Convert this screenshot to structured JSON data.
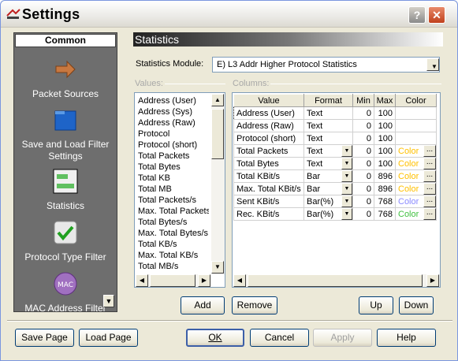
{
  "window": {
    "title": "Settings"
  },
  "left_panel": {
    "header": "Common",
    "items": [
      {
        "label": "Packet Sources",
        "icon": "arrow-icon"
      },
      {
        "label": "Save and Load Filter Settings",
        "icon": "folder-icon"
      },
      {
        "label": "Statistics",
        "icon": "statistics-icon"
      },
      {
        "label": "Protocol Type Filter",
        "icon": "checkmark-icon"
      },
      {
        "label": "MAC Address Filter",
        "icon": "mac-icon"
      }
    ]
  },
  "section_title": "Statistics",
  "module": {
    "label": "Statistics Module:",
    "value": "E)  L3 Addr Higher Protocol Statistics"
  },
  "values_group_label": "Values:",
  "columns_group_label": "Columns:",
  "values_list": [
    "Address (User)",
    "Address (Sys)",
    "Address (Raw)",
    "Protocol",
    "Protocol (short)",
    "Total Packets",
    "Total Bytes",
    "Total KB",
    "Total MB",
    "Total Packets/s",
    "Max. Total Packets",
    "Total Bytes/s",
    "Max. Total Bytes/s",
    "Total KB/s",
    "Max. Total KB/s",
    "Total MB/s"
  ],
  "columns_table": {
    "headers": [
      "Value",
      "Format",
      "Min",
      "Max",
      "Color"
    ],
    "rows": [
      {
        "value": "Address (User)",
        "format": "Text",
        "min": "0",
        "max": "100",
        "color": "",
        "dd": false
      },
      {
        "value": "Address (Raw)",
        "format": "Text",
        "min": "0",
        "max": "100",
        "color": "",
        "dd": false
      },
      {
        "value": "Protocol (short)",
        "format": "Text",
        "min": "0",
        "max": "100",
        "color": "",
        "dd": false
      },
      {
        "value": "Total Packets",
        "format": "Text",
        "min": "0",
        "max": "100",
        "color": "Color",
        "dd": true
      },
      {
        "value": "Total Bytes",
        "format": "Text",
        "min": "0",
        "max": "100",
        "color": "Color",
        "dd": true
      },
      {
        "value": "Total KBit/s",
        "format": "Bar",
        "min": "0",
        "max": "896",
        "color": "Color",
        "dd": true
      },
      {
        "value": "Max. Total KBit/s",
        "format": "Bar",
        "min": "0",
        "max": "896",
        "color": "Color",
        "dd": true
      },
      {
        "value": "Sent KBit/s",
        "format": "Bar(%)",
        "min": "0",
        "max": "768",
        "color": "Color",
        "dd": true
      },
      {
        "value": "Rec. KBit/s",
        "format": "Bar(%)",
        "min": "0",
        "max": "768",
        "color": "Color",
        "dd": true
      }
    ],
    "color_swatches": [
      "#ffc000",
      "#ffc000",
      "#ffc000",
      "#ffc000",
      "#8a8aff",
      "#40c040"
    ],
    "dots_label": "..."
  },
  "buttons": {
    "add": "Add",
    "remove": "Remove",
    "up": "Up",
    "down": "Down",
    "save_page": "Save Page",
    "load_page": "Load Page",
    "ok": "OK",
    "cancel": "Cancel",
    "apply": "Apply",
    "help": "Help"
  }
}
